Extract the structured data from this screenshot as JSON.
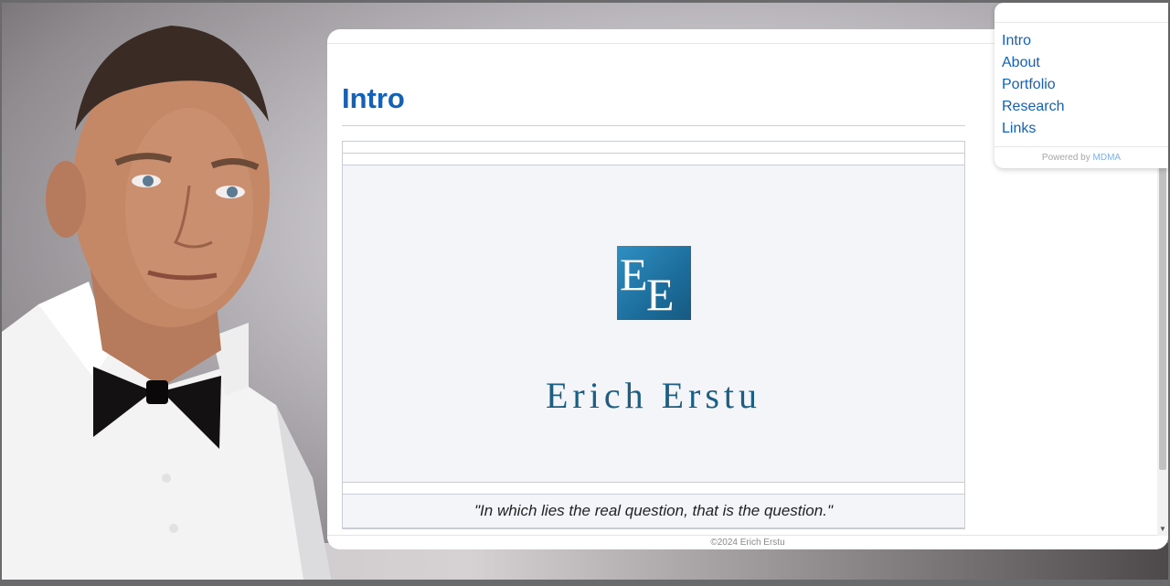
{
  "nav": {
    "items": [
      {
        "label": "Intro"
      },
      {
        "label": "About"
      },
      {
        "label": "Portfolio"
      },
      {
        "label": "Research"
      },
      {
        "label": "Links"
      }
    ],
    "powered_by_text": "Powered by",
    "powered_by_link": "MDMA"
  },
  "main": {
    "title": "Intro",
    "logo_monogram": "EE",
    "brand_name": "Erich Erstu",
    "quote": "\"In which lies the real question, that is the question.\""
  },
  "footer": {
    "copyright": "©2024 Erich Erstu"
  },
  "colors": {
    "link": "#1461b8",
    "logo_blue": "#2f8fc2",
    "brand_text": "#1d5f82"
  }
}
